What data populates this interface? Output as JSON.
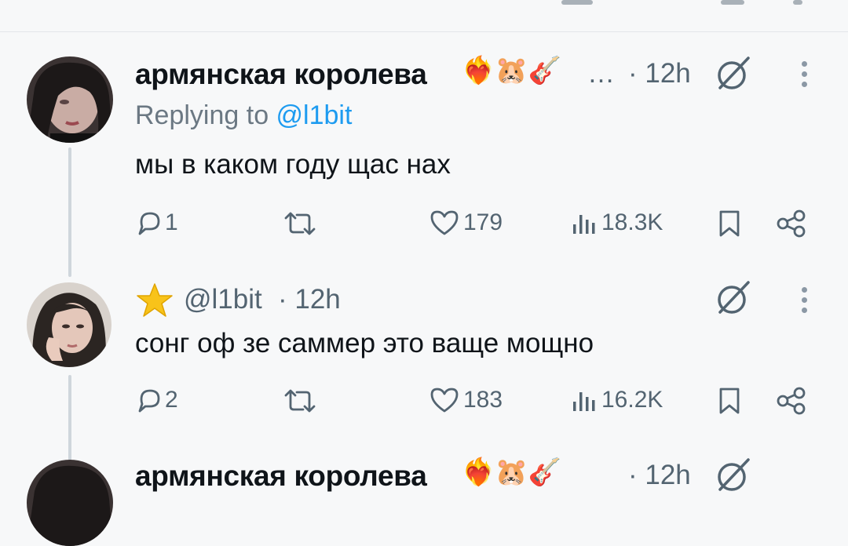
{
  "tweets": [
    {
      "author": "армянская королева",
      "author_emojis": "❤️‍🔥🐹🎸",
      "ellipsis": "…",
      "time": "· 12h",
      "replying_prefix": "Replying to ",
      "replying_handle": "@l1bit",
      "text": "мы в каком году щас нах",
      "replies": "1",
      "likes": "179",
      "views": "18.3K"
    },
    {
      "badge_emoji": "⭐",
      "handle": "@l1bit",
      "time": "· 12h",
      "text": "сонг оф зе саммер это ваще мощно",
      "replies": "2",
      "likes": "183",
      "views": "16.2K"
    },
    {
      "author": "армянская королева",
      "author_emojis": "❤️‍🔥🐹🎸",
      "time": "· 12h"
    }
  ],
  "icons": {
    "reply": "reply-bubble-icon",
    "retweet": "retweet-icon",
    "like": "heart-icon",
    "views": "bar-chart-icon",
    "bookmark": "bookmark-icon",
    "share": "share-icon",
    "grok": "grok-slash-circle-icon",
    "more": "more-vertical-icon"
  },
  "colors": {
    "link": "#1d9bf0",
    "muted": "#536471",
    "thread_line": "#cfd6dc"
  }
}
